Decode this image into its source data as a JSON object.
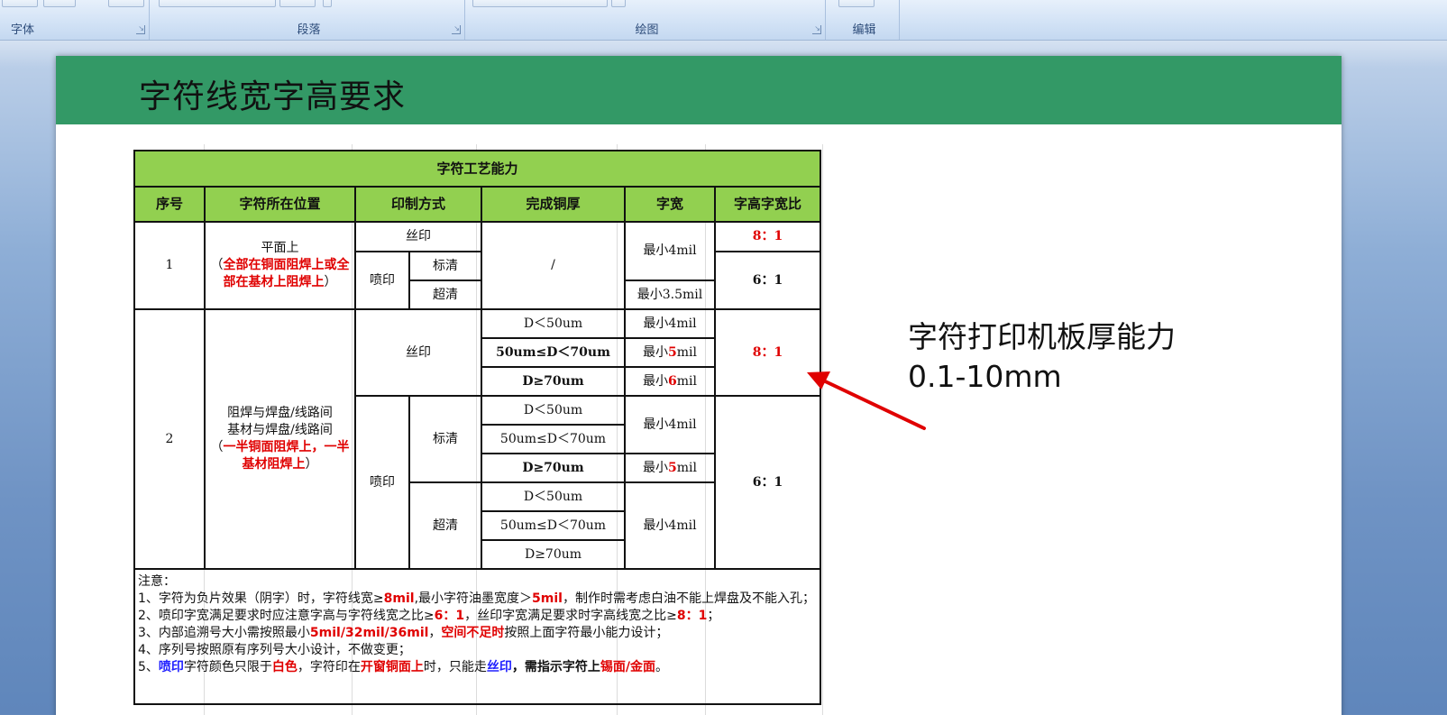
{
  "ribbon": {
    "groups": [
      {
        "label": "字体"
      },
      {
        "label": "段落"
      },
      {
        "label": "绘图"
      },
      {
        "label": "编辑"
      }
    ]
  },
  "slide": {
    "title": "字符线宽字高要求",
    "annotation": {
      "line1": "字符打印机板厚能力",
      "line2": "0.1-10mm"
    }
  },
  "table": {
    "caption": "字符工艺能力",
    "headers": [
      "序号",
      "字符所在位置",
      "印制方式",
      "完成铜厚",
      "字宽",
      "字高字宽比"
    ],
    "row1": {
      "no": "1",
      "pos_plain": "平面上",
      "pos_open": "（",
      "pos_red": "全部在铜面阻焊上或全部在基材上阻焊上",
      "pos_close": "）",
      "silk": "丝印",
      "inkjet": "喷印",
      "std": "标清",
      "hd": "超清",
      "cu": "/",
      "width_a": "最小4mil",
      "width_b": "最小3.5mil",
      "ratio_a": "8：1",
      "ratio_b": "6：1"
    },
    "row2": {
      "no": "2",
      "pos_line1": "阻焊与焊盘/线路间",
      "pos_line2": "基材与焊盘/线路间",
      "pos_open": "（",
      "pos_red": "一半铜面阻焊上，一半基材阻焊上",
      "pos_close": "）",
      "silk": "丝印",
      "inkjet": "喷印",
      "std": "标清",
      "hd": "超清",
      "cu1": "D＜50um",
      "cu2": "50um≤D＜70um",
      "cu3": "D≥70um",
      "w_prefix": "最小",
      "w_4": "最小4mil",
      "w_5_num": "5",
      "w_6_num": "6",
      "w_suffix": "mil",
      "ratio_silk": "8：1",
      "ratio_inkjet": "6：1"
    },
    "notes": {
      "heading": "注意：",
      "n1a": "1、字符为负片效果（阴字）时，字符线宽≥",
      "n1b": "8mil",
      "n1c": ",最小字符油墨宽度＞",
      "n1d": "5mil",
      "n1e": "，制作时需考虑白油不能上焊盘及不能入孔；",
      "n2a": "2、喷印字宽满足要求时应注意字高与字符线宽之比≥",
      "n2b": "6：1",
      "n2c": "，丝印字宽满足要求时字高线宽之比≥",
      "n2d": "8：1",
      "n2e": "；",
      "n3a": "3、内部追溯号大小需按照最小",
      "n3b": "5mil/32mil/36mil",
      "n3c": "，",
      "n3d": "空间不足时",
      "n3e": "按照上面字符最小能力设计；",
      "n4": "4、序列号按照原有序列号大小设计，不做变更；",
      "n5a": "5、",
      "n5b": "喷印",
      "n5c": "字符颜色只限于",
      "n5d": "白色",
      "n5e": "，字符印在",
      "n5f": "开窗铜面上",
      "n5g": "时，只能走",
      "n5h": "丝印",
      "n5i": "，需指示字符上",
      "n5j": "锡面/金面",
      "n5k": "。"
    }
  },
  "colors": {
    "title_bar": "#339966",
    "table_header": "#92d050",
    "emphasis": "#e00000",
    "highlight_blue": "#1f1fff",
    "arrow": "#e00000"
  }
}
